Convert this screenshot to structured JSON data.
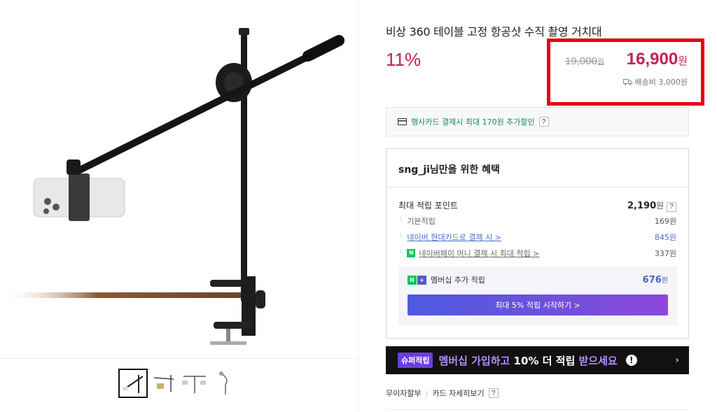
{
  "product": {
    "title": "비상 360 테이블 고정 항공샷 수직 촬영 거치대",
    "discount": "11%",
    "original_price": "19,000",
    "original_price_unit": "원",
    "sale_price": "16,900",
    "sale_price_unit": "원",
    "shipping": "배송비 3,000원"
  },
  "card_promo": {
    "text": "행사카드 결제시 최대 170원 추가할인",
    "help": "?"
  },
  "benefit": {
    "title": "sng_ji님만을 위한 혜택",
    "max_points_label": "최대 적립 포인트",
    "max_points_value": "2,190",
    "max_points_unit": "원",
    "help": "?",
    "rows": [
      {
        "label": "기본적립",
        "value": "169원"
      },
      {
        "label": "네이버 현대카드로 결제 시 >",
        "value": "845원"
      },
      {
        "label": "네이버페이 머니 결제 시 최대 적립 >",
        "value": "337원"
      }
    ],
    "membership": {
      "label": "멤버십 추가 적립",
      "value": "676",
      "unit": "원",
      "button": "최대 5% 적립 시작하기 >"
    }
  },
  "super_banner": {
    "badge": "슈퍼적립",
    "text_a": "멤버십 가입하고 ",
    "text_b": "10% 더 적립 ",
    "text_c": "받으세요",
    "chevron": "›"
  },
  "footer": {
    "link1": "무이자할부",
    "link2": "카드 자세히보기",
    "help": "?"
  },
  "colors": {
    "price": "#c4205a",
    "highlight": "#e50012",
    "naver_green": "#03c75a",
    "membership_blue": "#4e5fc4"
  }
}
